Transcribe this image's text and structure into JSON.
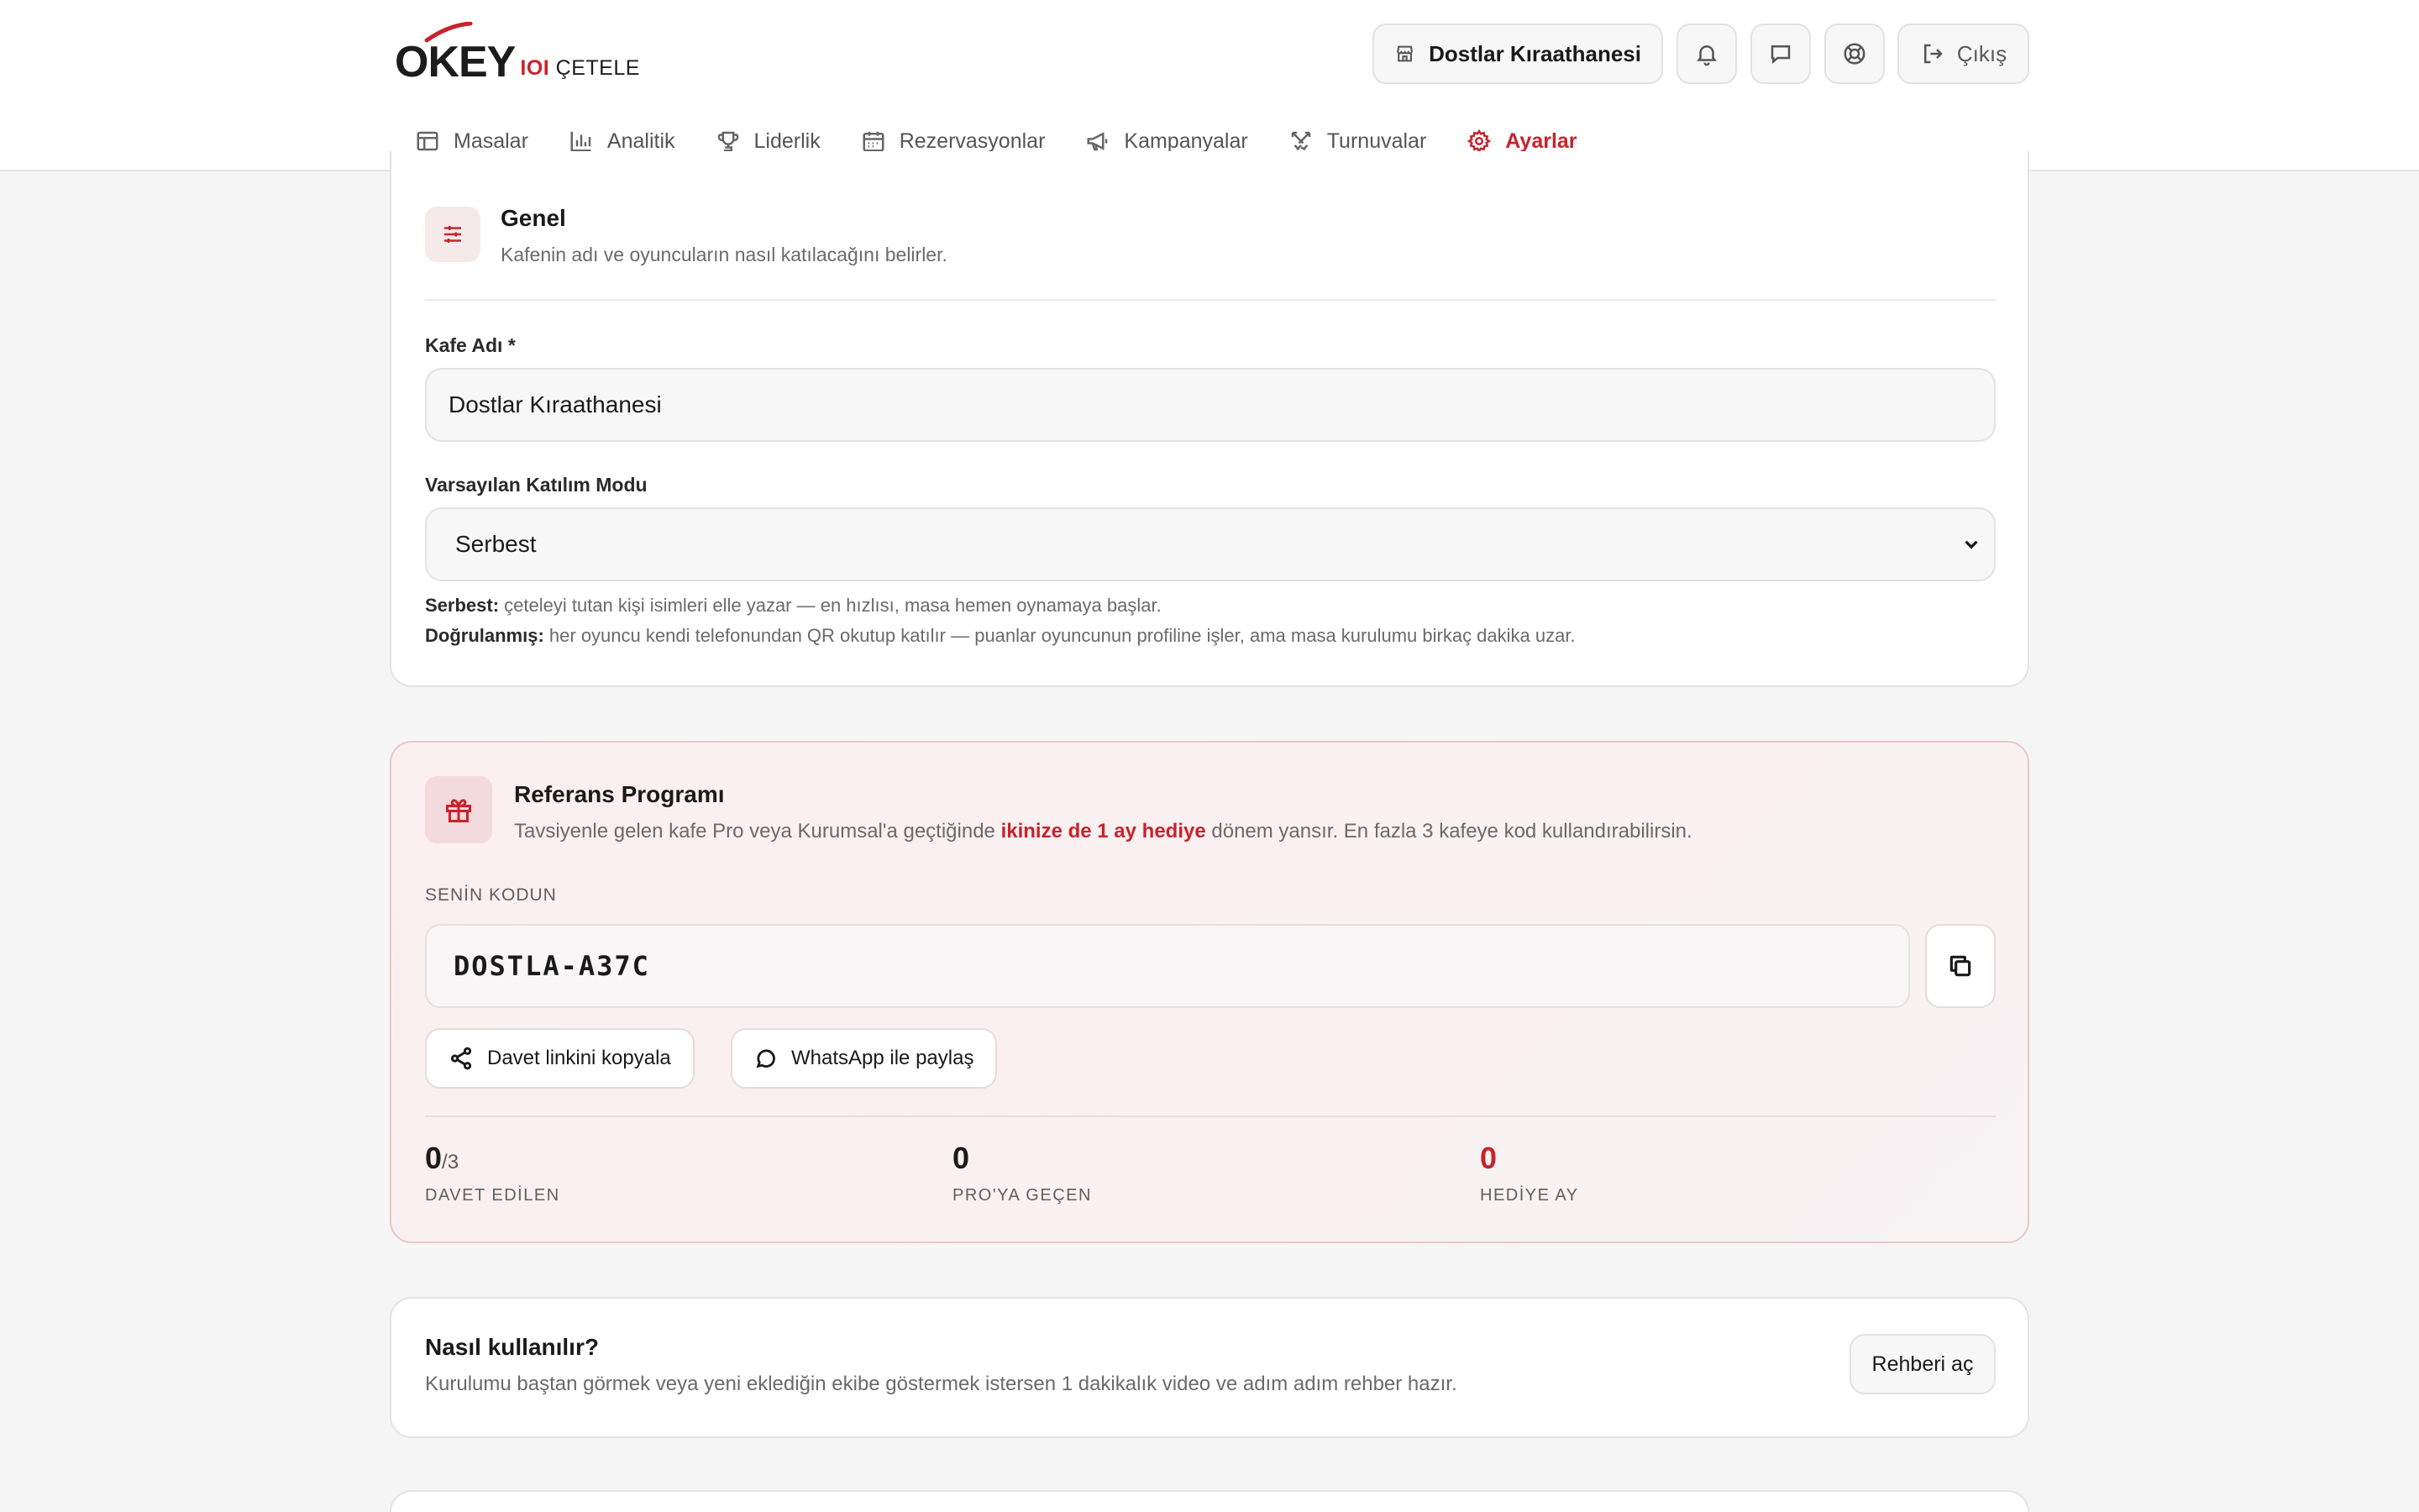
{
  "brand": {
    "logo_main": "OKEY",
    "logo_ioi": "IOI",
    "logo_sub": "ÇETELE"
  },
  "header": {
    "cafe_name": "Dostlar Kıraathanesi",
    "logout_label": "Çıkış",
    "icons": [
      "store-icon",
      "bell-icon",
      "message-icon",
      "lifebuoy-icon",
      "logout-icon"
    ]
  },
  "nav": {
    "items": [
      {
        "label": "Masalar",
        "icon": "table-icon"
      },
      {
        "label": "Analitik",
        "icon": "bar-chart-icon"
      },
      {
        "label": "Liderlik",
        "icon": "trophy-icon"
      },
      {
        "label": "Rezervasyonlar",
        "icon": "calendar-icon"
      },
      {
        "label": "Kampanyalar",
        "icon": "megaphone-icon"
      },
      {
        "label": "Turnuvalar",
        "icon": "swords-icon"
      },
      {
        "label": "Ayarlar",
        "icon": "gear-icon"
      }
    ],
    "active": "Ayarlar"
  },
  "general": {
    "title": "Genel",
    "description": "Kafenin adı ve oyuncuların nasıl katılacağını belirler.",
    "cafe_name_label": "Kafe Adı *",
    "cafe_name_value": "Dostlar Kıraathanesi",
    "mode_label": "Varsayılan Katılım Modu",
    "mode_value": "Serbest",
    "help_free_term": "Serbest:",
    "help_free_text": " çeteleyi tutan kişi isimleri elle yazar — en hızlısı, masa hemen oynamaya başlar.",
    "help_verified_term": "Doğrulanmış:",
    "help_verified_text": " her oyuncu kendi telefonundan QR okutup katılır — puanlar oyuncunun profiline işler, ama masa kurulumu birkaç dakika uzar."
  },
  "referral": {
    "title": "Referans Programı",
    "desc_before": "Tavsiyenle gelen kafe Pro veya Kurumsal'a geçtiğinde ",
    "desc_highlight": "ikinize de 1 ay hediye",
    "desc_after": " dönem yansır. En fazla 3 kafeye kod kullandırabilirsin.",
    "code_label": "SENİN KODUN",
    "code": "DOSTLA-A37C",
    "copy_link_label": "Davet linkini kopyala",
    "whatsapp_label": "WhatsApp ile paylaş",
    "stats": [
      {
        "value": "0",
        "suffix": "/3",
        "label": "DAVET EDİLEN"
      },
      {
        "value": "0",
        "suffix": "",
        "label": "PRO'YA GEÇEN"
      },
      {
        "value": "0",
        "suffix": "",
        "label": "HEDİYE AY"
      }
    ],
    "accent_color": "#c8232c"
  },
  "help_card": {
    "title": "Nasıl kullanılır?",
    "description": "Kurulumu baştan görmek veya yeni eklediğin ekibe göstermek istersen 1 dakikalık video ve adım adım rehber hazır.",
    "button_label": "Rehberi aç"
  }
}
